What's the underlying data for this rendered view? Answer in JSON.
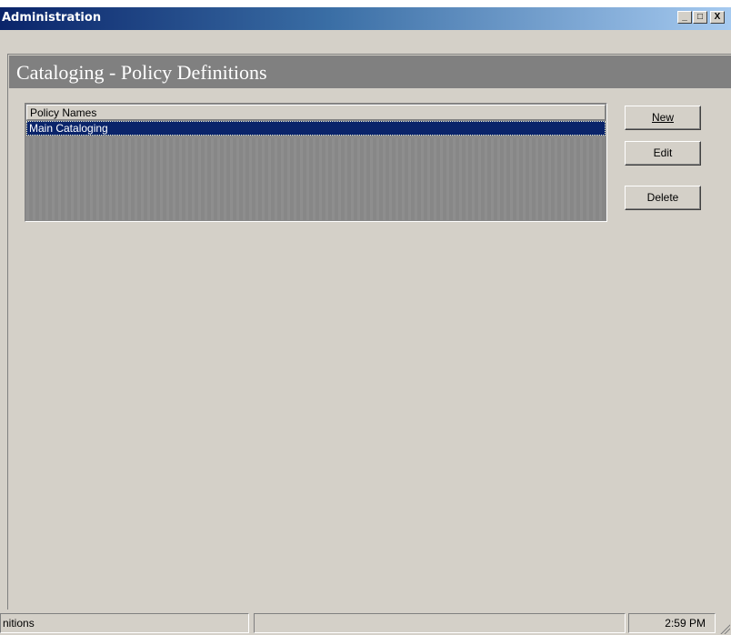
{
  "window": {
    "title": "Administration",
    "minimize_glyph": "_",
    "maximize_glyph": "□",
    "close_glyph": "X"
  },
  "banner": {
    "title": "Cataloging - Policy Definitions"
  },
  "policy_list": {
    "column_header": "Policy Names",
    "rows": [
      "Main Cataloging"
    ],
    "selected_index": 0
  },
  "buttons": {
    "new_label": "New",
    "edit_label": "Edit",
    "delete_label": "Delete"
  },
  "statusbar": {
    "left_text": "nitions",
    "middle_text": "",
    "time": "2:59 PM"
  },
  "colors": {
    "titlebar_start": "#0a246a",
    "titlebar_end": "#a6caf0",
    "selection": "#0a246a",
    "banner": "#808080"
  }
}
